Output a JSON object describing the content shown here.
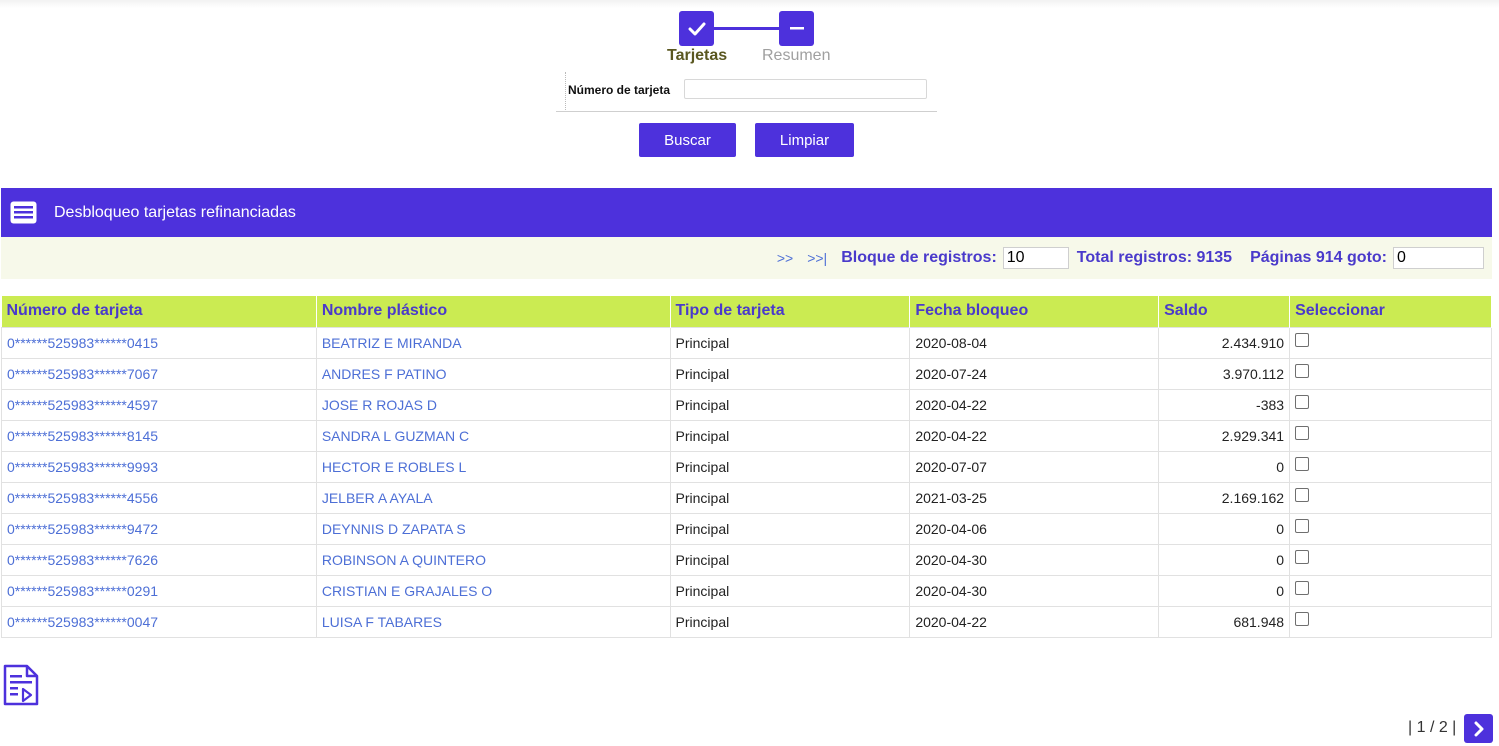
{
  "stepper": {
    "steps": [
      {
        "label": "Tarjetas",
        "state": "done",
        "icon": "check-icon"
      },
      {
        "label": "Resumen",
        "state": "pending",
        "icon": "minus-icon"
      }
    ]
  },
  "search": {
    "label": "Número de tarjeta",
    "value": "",
    "buscar_label": "Buscar",
    "limpiar_label": "Limpiar"
  },
  "panel": {
    "title": "Desbloqueo tarjetas refinanciadas",
    "icon": "list-card-icon"
  },
  "pager": {
    "next_label": ">>",
    "last_label": ">>|",
    "block_label": "Bloque de registros:",
    "block_value": "10",
    "total_label": "Total registros: 9135",
    "pages_label": "Páginas 914 goto:",
    "goto_value": "0"
  },
  "table": {
    "headers": [
      "Número de tarjeta",
      "Nombre plástico",
      "Tipo de tarjeta",
      "Fecha bloqueo",
      "Saldo",
      "Seleccionar"
    ],
    "rows": [
      {
        "card": "0******525983******0415",
        "name": "BEATRIZ E MIRANDA",
        "type": "Principal",
        "date": "2020-08-04",
        "balance": "2.434.910",
        "selected": false
      },
      {
        "card": "0******525983******7067",
        "name": "ANDRES F PATINO",
        "type": "Principal",
        "date": "2020-07-24",
        "balance": "3.970.112",
        "selected": false
      },
      {
        "card": "0******525983******4597",
        "name": "JOSE R ROJAS D",
        "type": "Principal",
        "date": "2020-04-22",
        "balance": "-383",
        "selected": false
      },
      {
        "card": "0******525983******8145",
        "name": "SANDRA L GUZMAN C",
        "type": "Principal",
        "date": "2020-04-22",
        "balance": "2.929.341",
        "selected": false
      },
      {
        "card": "0******525983******9993",
        "name": "HECTOR E ROBLES L",
        "type": "Principal",
        "date": "2020-07-07",
        "balance": "0",
        "selected": false
      },
      {
        "card": "0******525983******4556",
        "name": "JELBER A AYALA",
        "type": "Principal",
        "date": "2021-03-25",
        "balance": "2.169.162",
        "selected": false
      },
      {
        "card": "0******525983******9472",
        "name": "DEYNNIS D ZAPATA S",
        "type": "Principal",
        "date": "2020-04-06",
        "balance": "0",
        "selected": false
      },
      {
        "card": "0******525983******7626",
        "name": "ROBINSON A QUINTERO",
        "type": "Principal",
        "date": "2020-04-30",
        "balance": "0",
        "selected": false
      },
      {
        "card": "0******525983******0291",
        "name": "CRISTIAN E GRAJALES O",
        "type": "Principal",
        "date": "2020-04-30",
        "balance": "0",
        "selected": false
      },
      {
        "card": "0******525983******0047",
        "name": "LUISA F TABARES",
        "type": "Principal",
        "date": "2020-04-22",
        "balance": "681.948",
        "selected": false
      }
    ]
  },
  "footer": {
    "export_icon": "document-export-icon",
    "page_indicator": "| 1 / 2 |",
    "next_icon": "chevron-right-icon"
  },
  "colors": {
    "primary": "#4d31dc",
    "header_bg": "#cbeb52",
    "header_text": "#4a3acb",
    "link": "#4d6fd6",
    "pager_bg": "#f7f9ea"
  }
}
